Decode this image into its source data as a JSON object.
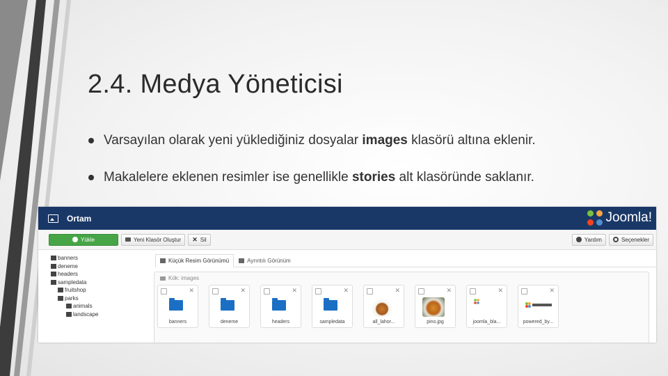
{
  "slide": {
    "title": "2.4. Medya Yöneticisi",
    "bullets": [
      {
        "before": "Varsayılan olarak yeni yüklediğiniz dosyalar ",
        "bold": "images",
        "after": " klasörü altına eklenir."
      },
      {
        "before": "Makalelere eklenen resimler ise genellikle ",
        "bold": "stories",
        "after": " alt klasöründe saklanır."
      }
    ]
  },
  "screenshot": {
    "window_title": "Ortam",
    "logo_text": "Joomla!",
    "toolbar": {
      "upload_label": "Yükle",
      "new_folder_label": "Yeni Klasör Oluştur",
      "delete_label": "Sil",
      "help_label": "Yardım",
      "options_label": "Seçenekler"
    },
    "tree": [
      {
        "label": "banners",
        "level": 0
      },
      {
        "label": "deneme",
        "level": 0
      },
      {
        "label": "headers",
        "level": 0
      },
      {
        "label": "sampledata",
        "level": 0
      },
      {
        "label": "fruitshop",
        "level": 1
      },
      {
        "label": "parks",
        "level": 1
      },
      {
        "label": "animals",
        "level": 2
      },
      {
        "label": "landscape",
        "level": 2
      }
    ],
    "tabs": [
      "Küçük Resim Görünümü",
      "Ayrıntılı Görünüm"
    ],
    "breadcrumb": "Kök: images",
    "thumbnails": [
      {
        "label": "banners",
        "kind": "folder"
      },
      {
        "label": "deneme",
        "kind": "folder"
      },
      {
        "label": "headers",
        "kind": "folder"
      },
      {
        "label": "sampledata",
        "kind": "folder"
      },
      {
        "label": "all_lahor...",
        "kind": "image"
      },
      {
        "label": "pino.jpg",
        "kind": "image"
      },
      {
        "label": "joomla_bla...",
        "kind": "logo"
      },
      {
        "label": "powered_by...",
        "kind": "logo-wide"
      }
    ],
    "colors": {
      "header_bg": "#1a3867",
      "upload_green": "#46a546",
      "folder_blue": "#1a6fc4"
    }
  }
}
